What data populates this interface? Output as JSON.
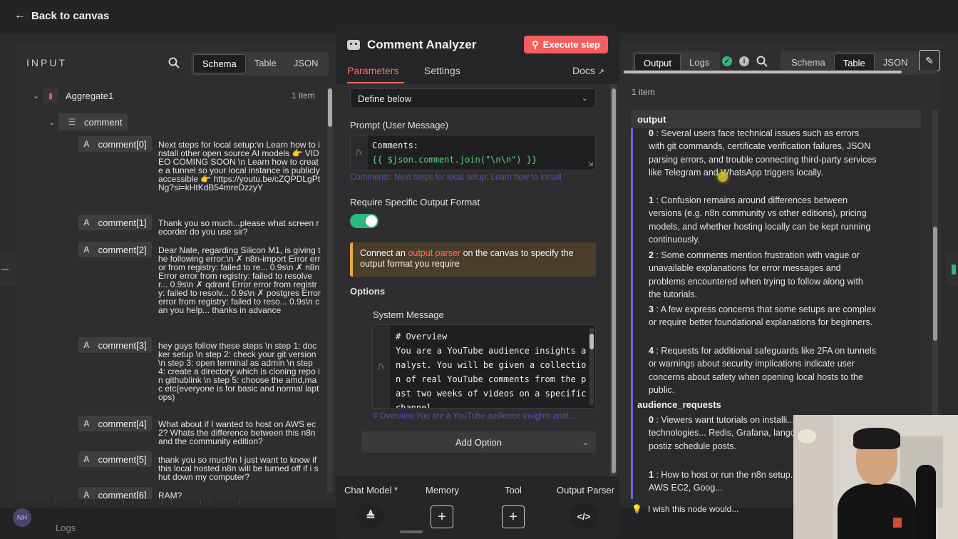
{
  "header": {
    "back_label": "Back to canvas"
  },
  "input_panel": {
    "title": "INPUT",
    "views": [
      "Schema",
      "Table",
      "JSON"
    ],
    "active_view": "Schema",
    "node_name": "Aggregate1",
    "node_count": "1 item",
    "field_name": "comment",
    "comments": [
      {
        "key": "comment[0]",
        "value": "Next steps for local setup:\\n Learn how to install other open source AI models 👉 VIDEO COMING SOON \\n Learn how to create a tunnel so your local instance is publicly accessible 👉 https://youtu.be/cZQPDLgPtNg?si=kHtKdB54mreDzzyY"
      },
      {
        "key": "comment[1]",
        "value": "Thank you so much...please what screen recorder do you use sir?"
      },
      {
        "key": "comment[2]",
        "value": "Dear Nate, regarding Silicon M1, is giving the following error:\\n ✗ n8n-import Error error from registry: failed to re... 0.9s\\n ✗ n8n Error error from registry: failed to resolve r... 0.9s\\n ✗ qdrant Error error from registry: failed to resolv... 0.9s\\n ✗ postgres Error error from registry: failed to reso... 0.9s\\n can you help... thanks in advance"
      },
      {
        "key": "comment[3]",
        "value": "hey guys follow these steps \\n step 1: docker setup \\n step 2: check your git version \\n step 3: open terminal as admin \\n step 4: create a directory which is cloning repo in githublink \\n step 5: choose the amd,mac etc(everyone is for basic and normal laptops)"
      },
      {
        "key": "comment[4]",
        "value": "What about if I wanted to host on AWS ec2? Whats the difference between this n8n and the community edition?"
      },
      {
        "key": "comment[5]",
        "value": "thank you so much\\n I just want to know if this local hosted n8n will be turned off if i shut down my computer?"
      },
      {
        "key": "comment[6]",
        "value": "RAM?"
      }
    ]
  },
  "node_panel": {
    "title": "Comment Analyzer",
    "execute_label": "Execute step",
    "tabs": [
      "Parameters",
      "Settings"
    ],
    "docs_label": "Docs",
    "source_select": "Define below",
    "prompt_label": "Prompt (User Message)",
    "prompt_line1": "Comments:",
    "prompt_line2": "{{ $json.comment.join(\"\\n\\n\") }}",
    "prompt_hint": "Comments: Next steps for local setup: Learn how to install",
    "require_format_label": "Require Specific Output Format",
    "require_format_on": true,
    "notice_before": "Connect an ",
    "notice_link": "output parser",
    "notice_after": " on the canvas to specify the output format you require",
    "options_label": "Options",
    "system_message_label": "System Message",
    "system_message": "# Overview\nYou are a YouTube audience insights analyst. You will be given a collection of real YouTube comments from the past two weeks of videos on a specific channel",
    "system_hint": "# Overview You are a YouTube audience insights anal...",
    "add_option_label": "Add Option",
    "connectors": [
      "Chat Model *",
      "Memory",
      "Tool",
      "Output Parser"
    ]
  },
  "output_panel": {
    "views_left": [
      "Output",
      "Logs"
    ],
    "active_left": "Output",
    "views_right": [
      "Schema",
      "Table",
      "JSON"
    ],
    "active_right": "Table",
    "count": "1 item",
    "column": "output",
    "items": [
      {
        "idx": "0",
        "text": "Several users face technical issues such as errors with git commands, certificate verification failures, JSON parsing errors, and trouble connecting third-party services like Telegram and WhatsApp triggers locally."
      },
      {
        "idx": "1",
        "text": "Confusion remains around differences between versions (e.g. n8n community vs other editions), pricing models, and whether hosting locally can be kept running continuously."
      },
      {
        "idx": "2",
        "text": "Some comments mention frustration with vague or unavailable explanations for error messages and problems encountered when trying to follow along with the tutorials."
      },
      {
        "idx": "3",
        "text": "A few express concerns that some setups are complex or require better foundational explanations for beginners."
      },
      {
        "idx": "4",
        "text": "Requests for additional safeguards like 2FA on tunnels or warnings about security implications indicate user concerns about safety when opening local hosts to the public."
      }
    ],
    "section2": "audience_requests",
    "requests": [
      {
        "idx": "0",
        "text": "Viewers want tutorials on installi... additional AI-related technologies... Redis, Grafana, langchain, embed... postiz schedule posts."
      },
      {
        "idx": "1",
        "text": "How to host or run the n8n setup... services such as AWS EC2, Goog..."
      }
    ],
    "wish_label": "I wish this node would..."
  },
  "footer": {
    "logs_label": "Logs",
    "avatar_initials": "NH"
  }
}
